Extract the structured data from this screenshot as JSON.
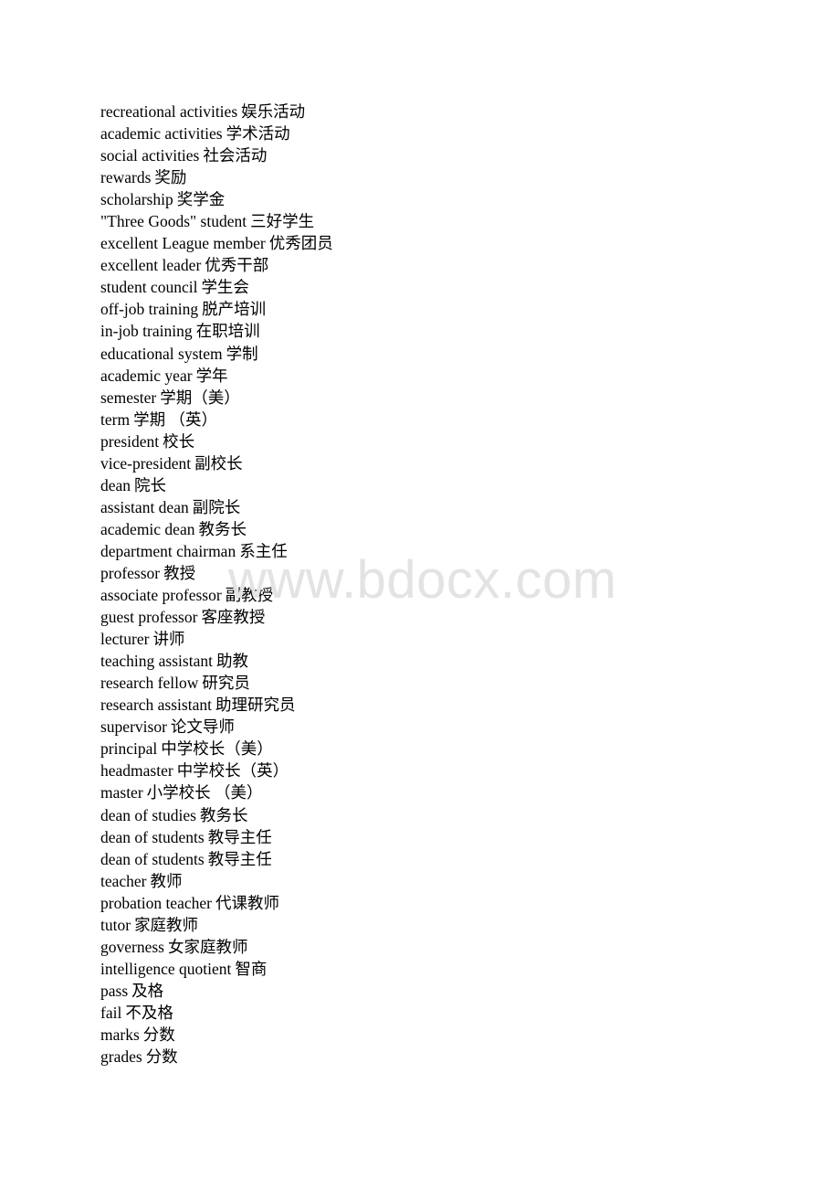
{
  "document": {
    "entries": [
      {
        "en": "recreational activities",
        "zh": "娱乐活动"
      },
      {
        "en": "academic activities",
        "zh": "学术活动"
      },
      {
        "en": "social activities",
        "zh": "社会活动"
      },
      {
        "en": "rewards",
        "zh": "奖励"
      },
      {
        "en": "scholarship",
        "zh": "奖学金"
      },
      {
        "en": "\"Three Goods\" student",
        "zh": "三好学生"
      },
      {
        "en": "excellent League member",
        "zh": "优秀团员"
      },
      {
        "en": "excellent leader",
        "zh": "优秀干部"
      },
      {
        "en": "student council",
        "zh": "学生会"
      },
      {
        "en": "off-job training",
        "zh": "脱产培训"
      },
      {
        "en": "in-job training",
        "zh": "在职培训"
      },
      {
        "en": "educational system",
        "zh": "学制"
      },
      {
        "en": "academic year",
        "zh": "学年"
      },
      {
        "en": "semester",
        "zh": "学期（美）"
      },
      {
        "en": "term",
        "zh": "学期 （英）"
      },
      {
        "en": "president",
        "zh": "校长"
      },
      {
        "en": "vice-president",
        "zh": "副校长"
      },
      {
        "en": "dean",
        "zh": "院长"
      },
      {
        "en": "assistant dean",
        "zh": "副院长"
      },
      {
        "en": "academic dean",
        "zh": "教务长"
      },
      {
        "en": "department chairman",
        "zh": "系主任"
      },
      {
        "en": "professor",
        "zh": "教授"
      },
      {
        "en": "associate professor",
        "zh": "副教授"
      },
      {
        "en": "guest professor",
        "zh": "客座教授"
      },
      {
        "en": "lecturer",
        "zh": "讲师"
      },
      {
        "en": "teaching assistant",
        "zh": "助教"
      },
      {
        "en": "research fellow",
        "zh": "研究员"
      },
      {
        "en": "research assistant",
        "zh": "助理研究员"
      },
      {
        "en": "supervisor",
        "zh": "论文导师"
      },
      {
        "en": "principal",
        "zh": "中学校长（美）"
      },
      {
        "en": "headmaster",
        "zh": "中学校长（英）"
      },
      {
        "en": "master",
        "zh": "小学校长 （美）"
      },
      {
        "en": "dean of studies",
        "zh": "教务长"
      },
      {
        "en": "dean of students",
        "zh": "教导主任"
      },
      {
        "en": "dean of students",
        "zh": "教导主任"
      },
      {
        "en": "teacher",
        "zh": "教师"
      },
      {
        "en": "probation teacher",
        "zh": "代课教师"
      },
      {
        "en": "tutor",
        "zh": "家庭教师"
      },
      {
        "en": "governess",
        "zh": "女家庭教师"
      },
      {
        "en": "intelligence quotient",
        "zh": "智商"
      },
      {
        "en": "pass",
        "zh": "及格"
      },
      {
        "en": "fail",
        "zh": "不及格"
      },
      {
        "en": "marks",
        "zh": "分数"
      },
      {
        "en": "grades",
        "zh": "分数"
      }
    ]
  },
  "watermark": {
    "text": "www.bdocx.com",
    "color": "#e3e3e3"
  }
}
